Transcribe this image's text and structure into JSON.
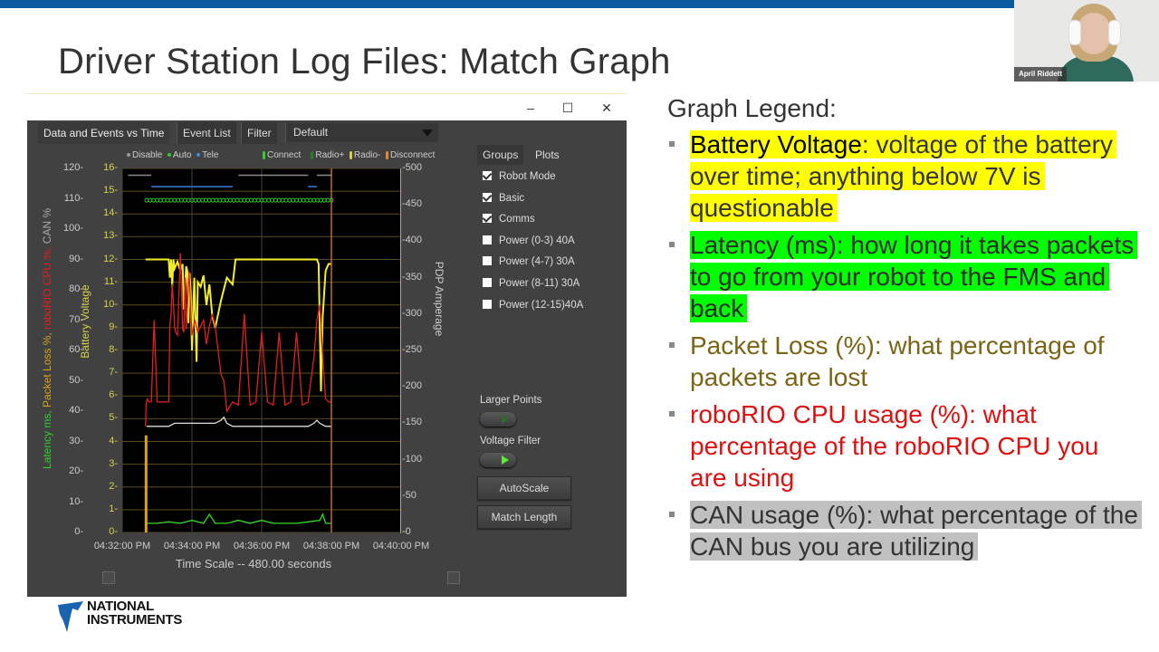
{
  "slide": {
    "title": "Driver Station Log Files: Match Graph",
    "brand_color": "#0b5aa0"
  },
  "webcam": {
    "presenter_name": "April Riddett"
  },
  "window": {
    "controls": {
      "minimize": "–",
      "maximize": "☐",
      "close": "✕"
    },
    "tabs": [
      {
        "label": "Data and Events vs Time",
        "active": true
      },
      {
        "label": "Event List",
        "active": false
      },
      {
        "label": "Filter",
        "active": false
      }
    ],
    "filter_select": {
      "value": "Default"
    },
    "legend": {
      "mode": [
        {
          "label": "Disable",
          "color": "#9a9a9a"
        },
        {
          "label": "Auto",
          "color": "#33cc33"
        },
        {
          "label": "Tele",
          "color": "#3a8fe0"
        }
      ],
      "events": [
        {
          "label": "Connect",
          "color": "#33cc33"
        },
        {
          "label": "Radio+",
          "color": "#2d7a2d"
        },
        {
          "label": "Radio-",
          "color": "#d6d14a"
        },
        {
          "label": "Disconnect",
          "color": "#e08a3a"
        }
      ]
    },
    "side_tabs": [
      {
        "label": "Groups",
        "active": true
      },
      {
        "label": "Plots",
        "active": false
      }
    ],
    "groups": [
      {
        "label": "Robot Mode",
        "checked": true
      },
      {
        "label": "Basic",
        "checked": true
      },
      {
        "label": "Comms",
        "checked": true
      },
      {
        "label": "Power (0-3) 40A",
        "checked": false
      },
      {
        "label": "Power (4-7) 30A",
        "checked": false
      },
      {
        "label": "Power (8-11) 30A",
        "checked": false
      },
      {
        "label": "Power (12-15)40A",
        "checked": false
      }
    ],
    "larger_points": {
      "label": "Larger Points",
      "on": false
    },
    "voltage_filter": {
      "label": "Voltage Filter",
      "on": true
    },
    "buttons": {
      "autoscale": "AutoScale",
      "match_length": "Match Length"
    }
  },
  "chart_data": {
    "type": "line",
    "title": "Data and Events vs Time",
    "xlabel": "Time Scale -- 480.00 seconds",
    "ylabel_left_parts": [
      {
        "text": "Latency ms, ",
        "color": "#33cc33"
      },
      {
        "text": "Packet Loss %, ",
        "color": "#d6a21e"
      },
      {
        "text": "roboRIO CPU %, ",
        "color": "#e02020"
      },
      {
        "text": "CAN %",
        "color": "#aaaaaa"
      }
    ],
    "ylabel_voltage": "Battery Voltage",
    "ylabel_right": "PDP Amperage",
    "x_ticks": [
      "04:32:00 PM",
      "04:34:00 PM",
      "04:36:00 PM",
      "04:38:00 PM",
      "04:40:00 PM"
    ],
    "x_range_seconds": [
      0,
      480
    ],
    "y_left_ticks": [
      "120",
      "110",
      "100",
      "90",
      "80",
      "70",
      "60",
      "50",
      "40",
      "30",
      "20",
      "10",
      "0"
    ],
    "y_left_range": [
      0,
      120
    ],
    "y_voltage_ticks": [
      "16",
      "15",
      "14",
      "13",
      "12",
      "11",
      "10",
      "9",
      "8",
      "7",
      "6",
      "5",
      "4",
      "3",
      "2",
      "1",
      "0"
    ],
    "y_voltage_range": [
      0,
      16
    ],
    "y_right_ticks": [
      "500",
      "450",
      "400",
      "350",
      "300",
      "250",
      "200",
      "150",
      "100",
      "50",
      "0"
    ],
    "y_right_range": [
      0,
      500
    ],
    "grid": true,
    "match_end_marker_s": 360,
    "series": [
      {
        "name": "Battery Voltage",
        "color": "#f2ef2a",
        "axis": "voltage",
        "x": [
          40,
          50,
          60,
          70,
          80,
          82,
          84,
          86,
          88,
          90,
          95,
          100,
          104,
          106,
          110,
          112,
          114,
          116,
          118,
          120,
          124,
          128,
          130,
          135,
          140,
          145,
          150,
          155,
          160,
          170,
          180,
          190,
          195,
          200,
          210,
          220,
          225,
          230,
          240,
          250,
          260,
          270,
          280,
          300,
          320,
          330,
          335,
          338,
          340,
          342,
          345,
          350,
          355,
          360
        ],
        "values": [
          12.0,
          12.0,
          12.0,
          12.0,
          12.0,
          11.2,
          12.0,
          10.8,
          12.0,
          11.6,
          11.9,
          11.5,
          11.8,
          9.8,
          11.7,
          11.5,
          9.2,
          11.4,
          10.4,
          8.0,
          11.2,
          7.5,
          11.0,
          10.8,
          11.3,
          10.0,
          10.9,
          9.5,
          9.0,
          10.2,
          11.2,
          10.9,
          12.0,
          12.0,
          12.0,
          12.0,
          12.0,
          12.0,
          12.0,
          12.0,
          12.0,
          12.0,
          12.0,
          12.0,
          12.0,
          12.0,
          12.0,
          11.8,
          9.0,
          6.2,
          9.5,
          11.5,
          11.8,
          11.8
        ]
      },
      {
        "name": "roboRIO CPU %",
        "color": "#e02020",
        "axis": "left",
        "x": [
          40,
          41,
          43,
          46,
          50,
          55,
          60,
          70,
          75,
          80,
          82,
          84,
          86,
          88,
          90,
          92,
          95,
          100,
          104,
          106,
          108,
          110,
          115,
          120,
          125,
          130,
          135,
          140,
          145,
          150,
          155,
          160,
          165,
          170,
          175,
          180,
          190,
          200,
          210,
          220,
          230,
          240,
          250,
          260,
          270,
          280,
          290,
          300,
          310,
          320,
          330,
          335,
          340,
          345,
          350,
          355,
          360
        ],
        "values": [
          35,
          42,
          44,
          43,
          43,
          70,
          43,
          43,
          43,
          43,
          68,
          72,
          82,
          76,
          68,
          66,
          65,
          92,
          67,
          66,
          84,
          67,
          86,
          65,
          70,
          66,
          68,
          70,
          62,
          68,
          72,
          68,
          60,
          52,
          50,
          40,
          43,
          42,
          72,
          42,
          43,
          66,
          43,
          42,
          66,
          42,
          43,
          66,
          42,
          43,
          58,
          70,
          75,
          58,
          44,
          43,
          43
        ]
      },
      {
        "name": "CAN %",
        "color": "#dddddd",
        "axis": "left",
        "x": [
          42,
          60,
          80,
          90,
          100,
          110,
          120,
          130,
          140,
          150,
          160,
          170,
          175,
          180,
          190,
          200,
          220,
          240,
          260,
          280,
          300,
          320,
          330,
          335,
          340,
          350,
          360
        ],
        "values": [
          35,
          35,
          35,
          36,
          36,
          36,
          36,
          36,
          36,
          36,
          36,
          37,
          38,
          36,
          35,
          35,
          35,
          35,
          35,
          35,
          35,
          35,
          36,
          37,
          36,
          35,
          35
        ]
      },
      {
        "name": "Latency ms",
        "color": "#33dd22",
        "axis": "left",
        "x": [
          42,
          60,
          80,
          100,
          120,
          140,
          150,
          160,
          180,
          200,
          220,
          240,
          260,
          280,
          300,
          320,
          340,
          345,
          350,
          360
        ],
        "values": [
          3,
          3,
          3.5,
          3,
          4,
          3,
          6,
          3,
          3,
          4,
          3,
          4,
          3,
          3,
          3,
          3.5,
          4,
          6,
          3,
          3
        ]
      },
      {
        "name": "Packet Loss %",
        "color": "#e0a020",
        "axis": "left",
        "x": [
          41,
          41
        ],
        "values": [
          0,
          32
        ]
      }
    ],
    "robot_mode": {
      "disable_segments_s": [
        [
          10,
          50
        ],
        [
          200,
          320
        ],
        [
          335,
          360
        ]
      ],
      "tele_segments_s": [
        [
          50,
          190
        ],
        [
          320,
          335
        ]
      ]
    },
    "comms_connected_range_s": [
      42,
      360
    ]
  },
  "legend_panel": {
    "title": "Graph Legend:",
    "items": [
      {
        "name": "Battery Voltage",
        "rest": ": voltage of the battery over time; anything below 7V is questionable",
        "text_color": "#333333",
        "name_color": "#000000",
        "highlight": "#ffff00"
      },
      {
        "name": "Latency (ms)",
        "rest": ": how long it takes packets to go from your robot to the FMS and back",
        "text_color": "#2a2a2a",
        "name_color": "#2a2a2a",
        "highlight": "#00ff00"
      },
      {
        "name": "Packet Loss (%)",
        "rest": ": what percentage of packets are lost",
        "text_color": "#7a6516",
        "name_color": "#7a6516",
        "highlight": ""
      },
      {
        "name": "roboRIO CPU usage (%)",
        "rest": ": what percentage of the roboRIO CPU you are using",
        "text_color": "#dd1111",
        "name_color": "#dd1111",
        "highlight": ""
      },
      {
        "name": "CAN usage (%)",
        "rest": ": what percentage of the CAN bus you are utilizing",
        "text_color": "#333333",
        "name_color": "#333333",
        "highlight": "#c0c0c0"
      }
    ]
  },
  "logo": {
    "line1": "NATIONAL",
    "line2": "INSTRUMENTS"
  }
}
